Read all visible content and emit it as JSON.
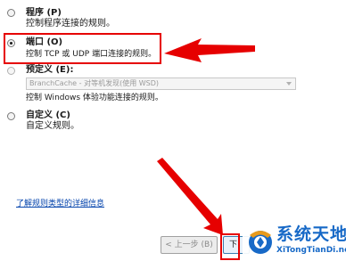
{
  "options": [
    {
      "label": "程序 (P)",
      "description": "控制程序连接的规则。",
      "checked": false
    },
    {
      "label": "端口 (O)",
      "description": "控制 TCP 或 UDP 端口连接的规则。",
      "checked": true
    },
    {
      "label": "预定义 (E):",
      "description": "控制 Windows 体验功能连接的规则。",
      "checked": false
    },
    {
      "label": "自定义 (C)",
      "description": "自定义规则。",
      "checked": false
    }
  ],
  "predefined_dropdown": {
    "value": "BranchCache - 对等机发现(使用 WSD)"
  },
  "help_link": "了解规则类型的详细信息",
  "buttons": {
    "back": "< 上一步 (B)",
    "next": "下"
  },
  "watermark": {
    "title": "系统天地",
    "url": "XiTongTianDi.net"
  },
  "colors": {
    "annotation_red": "#e60000",
    "link_blue": "#0645ad",
    "logo_blue": "#1769c7"
  }
}
